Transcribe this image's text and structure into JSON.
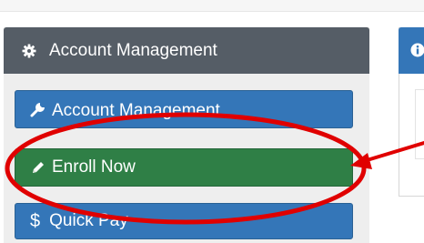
{
  "panel": {
    "header_icon": "gear-icon",
    "title": "Account Management",
    "buttons": [
      {
        "label": "Account Management",
        "icon": "wrench-icon",
        "color": "#3476b8"
      },
      {
        "label": "Enroll Now",
        "icon": "pencil-icon",
        "color": "#2f7f46"
      },
      {
        "label": "Quick Pay",
        "icon": "dollar-icon",
        "icon_text": "$",
        "color": "#3476b8"
      }
    ]
  },
  "right_panel": {
    "header_icon": "info-icon",
    "header_color": "#3476b8"
  },
  "annotation": {
    "shape": "ellipse",
    "color": "#e00000",
    "target": "Enroll Now",
    "arrow": "pointing left"
  }
}
